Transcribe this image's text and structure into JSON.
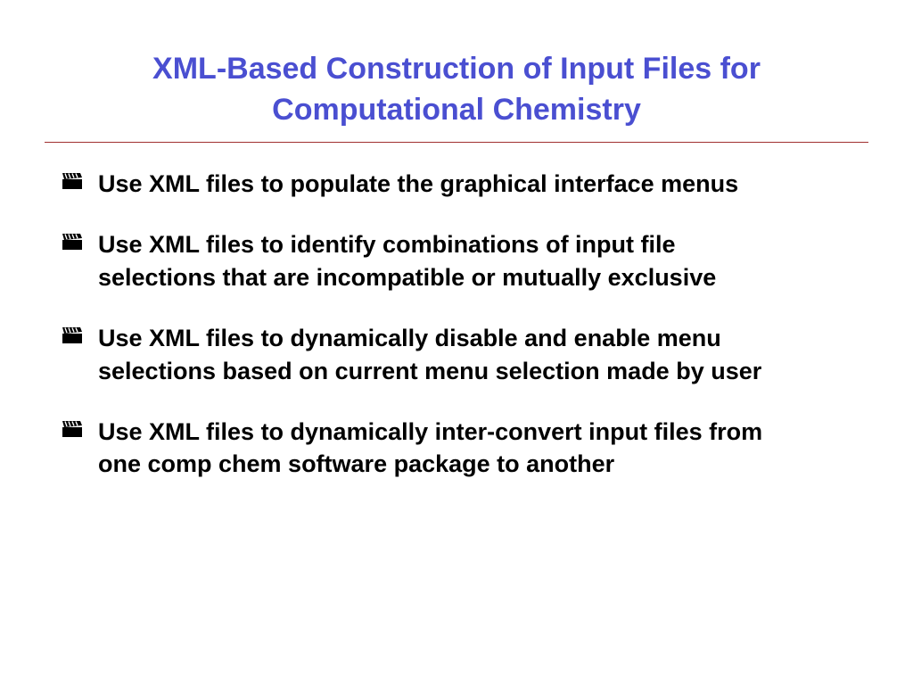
{
  "title": "XML-Based Construction of Input Files for Computational Chemistry",
  "bullets": [
    {
      "text": "Use XML files to populate the graphical interface menus"
    },
    {
      "text": "Use XML files to identify combinations of input file selections that are incompatible or mutually exclusive"
    },
    {
      "text": "Use XML files to dynamically disable and enable menu selections based on current menu selection made by user"
    },
    {
      "text": "Use XML files to dynamically inter-convert input files from one comp chem software package to another"
    }
  ],
  "colors": {
    "title": "#4a4fd1",
    "divider": "#a03030",
    "body": "#000000",
    "background": "#ffffff"
  },
  "icon_name": "clapboard-icon"
}
